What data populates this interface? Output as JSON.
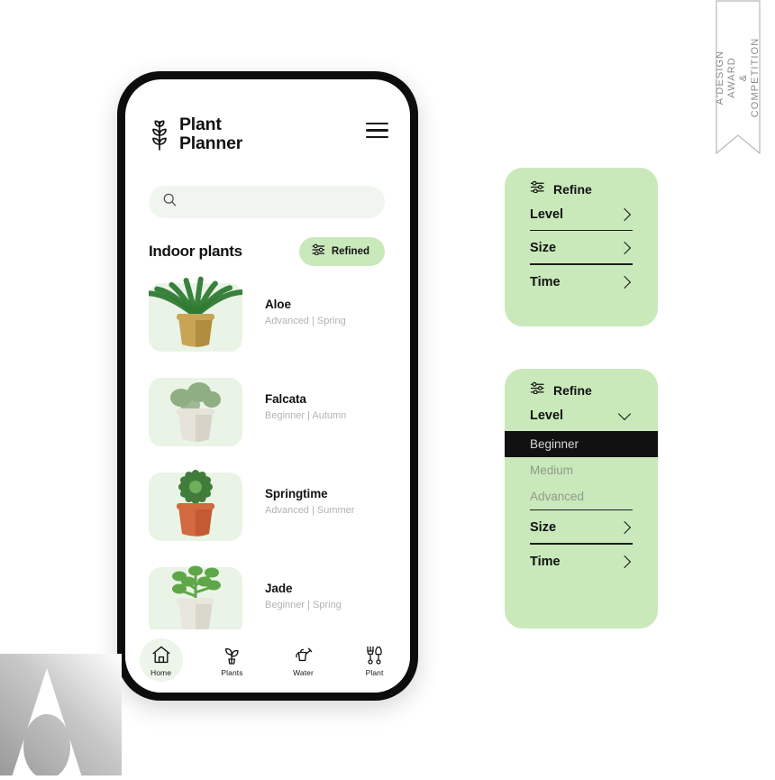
{
  "app": {
    "brand_name": "Plant\nPlanner",
    "logo_icon": "sprout-icon",
    "menu_icon": "hamburger-menu-icon"
  },
  "search": {
    "icon": "search-icon",
    "value": "",
    "placeholder": ""
  },
  "section": {
    "title": "Indoor plants",
    "refined_label": "Refined",
    "refined_icon": "filter-sliders-icon"
  },
  "plants": [
    {
      "name": "Aloe",
      "meta": "Advanced | Spring",
      "pot": "#c8a454",
      "pot2": "#9d7a2e",
      "leaf": "#2f7a33"
    },
    {
      "name": "Falcata",
      "meta": "Beginner  | Autumn",
      "pot": "#e6e3da",
      "pot2": "#cbc7bb",
      "leaf": "#8fae84"
    },
    {
      "name": "Springtime",
      "meta": "Advanced | Summer",
      "pot": "#d2693f",
      "pot2": "#b4512c",
      "leaf": "#3f7c3a"
    },
    {
      "name": "Jade",
      "meta": "Beginner | Spring",
      "pot": "#e8e6dd",
      "pot2": "#cdcabf",
      "leaf": "#5fa649"
    },
    {
      "name": "",
      "meta": "",
      "pot": "#e0ddd4",
      "pot2": "#c6c2b7",
      "leaf": "#6aa858"
    }
  ],
  "bottom_nav": [
    {
      "label": "Home",
      "icon": "home-icon",
      "active": true
    },
    {
      "label": "Plants",
      "icon": "potted-plant-icon",
      "active": false
    },
    {
      "label": "Water",
      "icon": "watering-can-icon",
      "active": false
    },
    {
      "label": "Plant",
      "icon": "garden-tools-icon",
      "active": false
    }
  ],
  "refine_collapsed": {
    "title": "Refine",
    "icon": "filter-sliders-icon",
    "rows": [
      {
        "label": "Level",
        "chevron": "chevron-right-icon"
      },
      {
        "label": "Size",
        "chevron": "chevron-right-icon"
      },
      {
        "label": "Time",
        "chevron": "chevron-right-icon"
      }
    ]
  },
  "refine_expanded": {
    "title": "Refine",
    "icon": "filter-sliders-icon",
    "level_label": "Level",
    "level_chevron": "chevron-down-icon",
    "options": [
      {
        "label": "Beginner",
        "selected": true
      },
      {
        "label": "Medium",
        "selected": false
      },
      {
        "label": "Advanced",
        "selected": false
      }
    ],
    "rows": [
      {
        "label": "Size",
        "chevron": "chevron-right-icon"
      },
      {
        "label": "Time",
        "chevron": "chevron-right-icon"
      }
    ]
  },
  "award": {
    "ribbon_text": "A'DESIGN AWARD\n& COMPETITION"
  },
  "colors": {
    "brand_green": "#c9e9bb",
    "pale_green": "#eaf4e6",
    "search_green": "#f0f6ef",
    "ink": "#121212",
    "muted": "#b3b3b3"
  }
}
